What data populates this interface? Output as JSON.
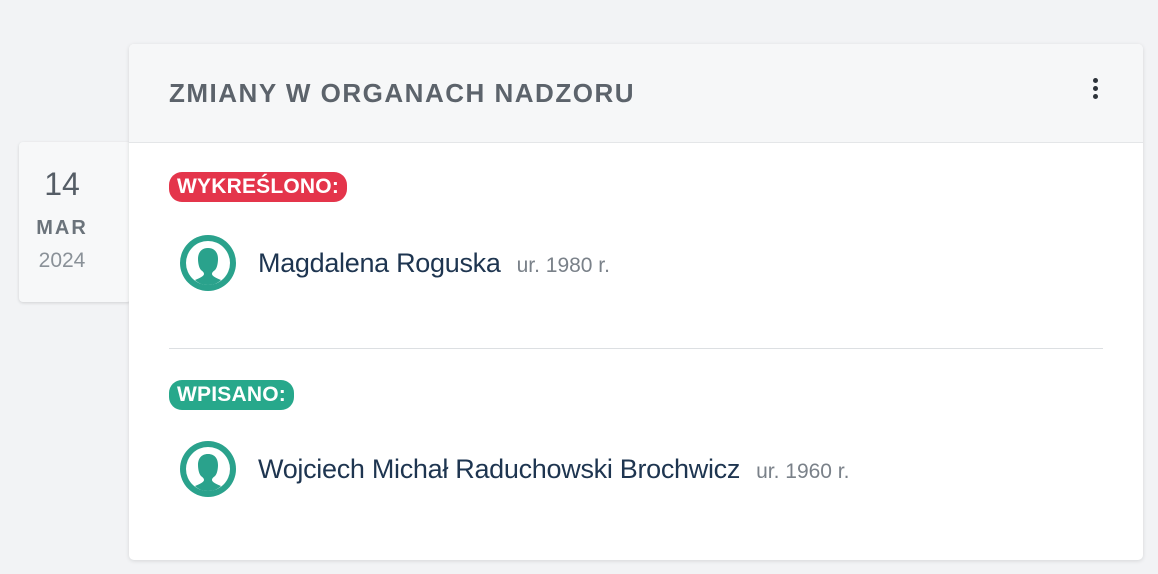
{
  "date": {
    "day": "14",
    "month": "MAR",
    "year": "2024"
  },
  "card": {
    "title": "ZMIANY W ORGANACH NADZORU",
    "menu_icon": "more-vertical-icon"
  },
  "sections": [
    {
      "badge": "WYKREŚLONO:",
      "badge_color": "#e4354b",
      "person": {
        "name": "Magdalena Roguska",
        "born": "ur. 1980 r.",
        "icon": "person-avatar-icon"
      }
    },
    {
      "badge": "WPISANO:",
      "badge_color": "#27a88b",
      "person": {
        "name": "Wojciech Michał Raduchowski Brochwicz",
        "born": "ur. 1960 r.",
        "icon": "person-avatar-icon"
      }
    }
  ],
  "colors": {
    "avatar": "#2aa28c",
    "name": "#1e3550"
  }
}
